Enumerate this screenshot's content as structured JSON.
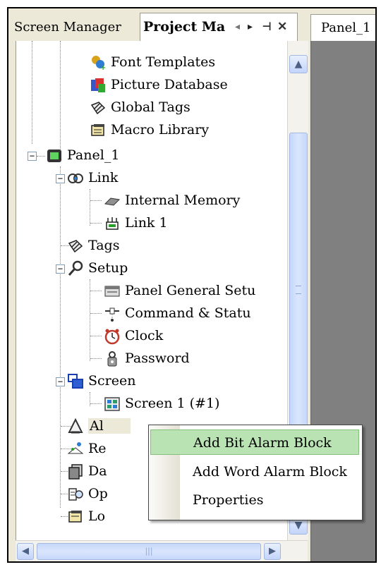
{
  "tabs": {
    "screen_manager": "Screen Manager",
    "project_manager": "Project Ma",
    "controls": {
      "left": "◂",
      "right": "▸",
      "pin": "⊣",
      "close": "✕"
    }
  },
  "tree": {
    "items": [
      {
        "label": "Font Templates",
        "icon": "font-templates-icon"
      },
      {
        "label": "Picture Database",
        "icon": "picture-database-icon"
      },
      {
        "label": "Global Tags",
        "icon": "global-tags-icon"
      },
      {
        "label": "Macro Library",
        "icon": "macro-library-icon"
      },
      {
        "label": "Panel_1",
        "icon": "panel-icon",
        "expander": "−"
      },
      {
        "label": "Link",
        "icon": "link-icon",
        "expander": "−"
      },
      {
        "label": "Internal Memory",
        "icon": "memory-chip-icon"
      },
      {
        "label": "Link 1",
        "icon": "link-device-icon"
      },
      {
        "label": "Tags",
        "icon": "tags-icon"
      },
      {
        "label": "Setup",
        "icon": "setup-wrench-icon",
        "expander": "−"
      },
      {
        "label": "Panel General Setu",
        "icon": "panel-setup-icon"
      },
      {
        "label": "Command & Statu",
        "icon": "command-status-icon"
      },
      {
        "label": "Clock",
        "icon": "clock-icon"
      },
      {
        "label": "Password",
        "icon": "password-icon"
      },
      {
        "label": "Screen",
        "icon": "screen-folder-icon",
        "expander": "−"
      },
      {
        "label": "Screen 1 (#1)",
        "icon": "screen-page-icon"
      },
      {
        "label": "Al",
        "icon": "alarm-bell-icon",
        "selected": true
      },
      {
        "label": "Re",
        "icon": "recipe-icon"
      },
      {
        "label": "Da",
        "icon": "data-log-icon"
      },
      {
        "label": "Op",
        "icon": "operation-log-icon"
      },
      {
        "label": "Lo",
        "icon": "log-folder-icon"
      }
    ]
  },
  "scroll": {
    "up": "▲",
    "down": "▼",
    "left": "◀",
    "right": "▶",
    "hgrip": "|||"
  },
  "document": {
    "tab_label": "Panel_1"
  },
  "context_menu": {
    "items": [
      {
        "label": "Add Bit Alarm Block",
        "highlighted": true
      },
      {
        "label": "Add Word Alarm Block"
      },
      {
        "label": "Properties"
      }
    ]
  },
  "colors": {
    "menu_highlight": "#b9e3b3",
    "scroll_thumb": "#c6d7fb",
    "document_background": "#808080"
  }
}
